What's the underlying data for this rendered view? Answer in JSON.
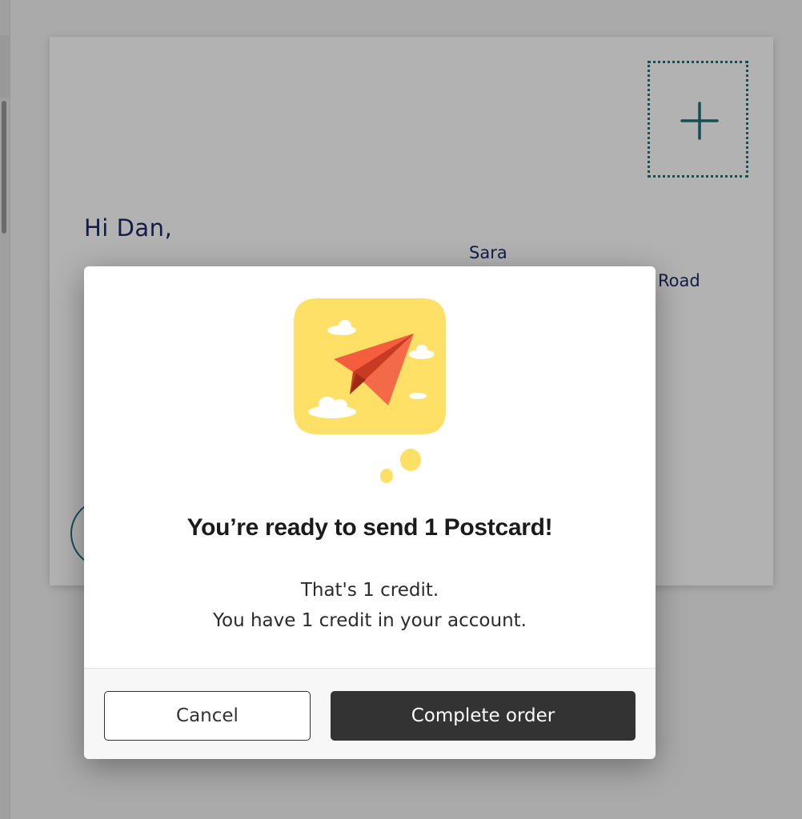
{
  "postcard": {
    "greeting": "Hi Dan,",
    "recipient_name": "Sara",
    "address_fragment": "Road",
    "stamp_icon": "plus-icon"
  },
  "modal": {
    "title": "You’re ready to send 1 Postcard!",
    "line1": "That's 1 credit.",
    "line2": "You have 1 credit in your account.",
    "illustration_icon": "paper-plane-icon",
    "cancel_label": "Cancel",
    "complete_label": "Complete order"
  },
  "colors": {
    "accent_teal": "#1e7176",
    "text_navy": "#1d2a66",
    "illustration_yellow": "#ffe066",
    "plane_orange": "#f45d3e",
    "primary_button": "#333333"
  }
}
